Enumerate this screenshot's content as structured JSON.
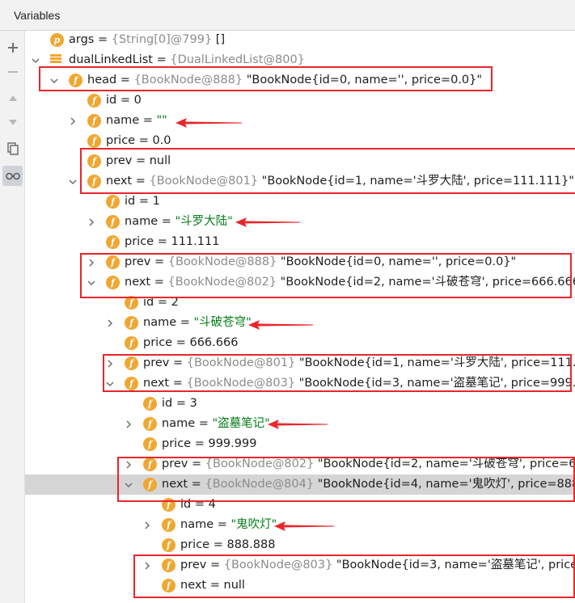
{
  "panel": {
    "title": "Variables"
  },
  "toolbar": [
    {
      "icon": "plus-icon",
      "glyph": "+"
    },
    {
      "icon": "minus-icon",
      "glyph": "−"
    },
    {
      "icon": "arrow-up-icon",
      "glyph": "▲"
    },
    {
      "icon": "arrow-down-icon",
      "glyph": "▼"
    },
    {
      "icon": "copy-icon",
      "glyph": "❐"
    },
    {
      "icon": "glasses-icon",
      "glyph": "👓"
    }
  ],
  "rows": [
    {
      "indent": 0,
      "chev": "",
      "icon": "p",
      "name": "args",
      "ref": "{String[0]@799}",
      "value": "[]",
      "valueColor": "black"
    },
    {
      "indent": 0,
      "chev": "down",
      "icon": "list",
      "name": "dualLinkedList",
      "ref": "{DualLinkedList@800}",
      "value": "",
      "valueColor": "black"
    },
    {
      "indent": 1,
      "chev": "down",
      "icon": "f",
      "name": "head",
      "ref": "{BookNode@888}",
      "value": "\"BookNode{id=0, name='', price=0.0}\"",
      "valueColor": "black"
    },
    {
      "indent": 2,
      "chev": "",
      "icon": "f",
      "name": "id",
      "ref": "",
      "value": "0",
      "valueColor": "black"
    },
    {
      "indent": 2,
      "chev": "right",
      "icon": "f",
      "name": "name",
      "ref": "",
      "value": "\"\"",
      "valueColor": "green"
    },
    {
      "indent": 2,
      "chev": "",
      "icon": "f",
      "name": "price",
      "ref": "",
      "value": "0.0",
      "valueColor": "black"
    },
    {
      "indent": 2,
      "chev": "",
      "icon": "f",
      "name": "prev",
      "ref": "",
      "value": "null",
      "valueColor": "black"
    },
    {
      "indent": 2,
      "chev": "down",
      "icon": "f",
      "name": "next",
      "ref": "{BookNode@801}",
      "value": "\"BookNode{id=1, name='斗罗大陆', price=111.111}\"",
      "valueColor": "black"
    },
    {
      "indent": 3,
      "chev": "",
      "icon": "f",
      "name": "id",
      "ref": "",
      "value": "1",
      "valueColor": "black"
    },
    {
      "indent": 3,
      "chev": "right",
      "icon": "f",
      "name": "name",
      "ref": "",
      "value": "\"斗罗大陆\"",
      "valueColor": "green"
    },
    {
      "indent": 3,
      "chev": "",
      "icon": "f",
      "name": "price",
      "ref": "",
      "value": "111.111",
      "valueColor": "black"
    },
    {
      "indent": 3,
      "chev": "right",
      "icon": "f",
      "name": "prev",
      "ref": "{BookNode@888}",
      "value": "\"BookNode{id=0, name='', price=0.0}\"",
      "valueColor": "black"
    },
    {
      "indent": 3,
      "chev": "down",
      "icon": "f",
      "name": "next",
      "ref": "{BookNode@802}",
      "value": "\"BookNode{id=2, name='斗破苍穹', price=666.666",
      "valueColor": "black"
    },
    {
      "indent": 4,
      "chev": "",
      "icon": "f",
      "name": "id",
      "ref": "",
      "value": "2",
      "valueColor": "black"
    },
    {
      "indent": 4,
      "chev": "right",
      "icon": "f",
      "name": "name",
      "ref": "",
      "value": "\"斗破苍穹\"",
      "valueColor": "green"
    },
    {
      "indent": 4,
      "chev": "",
      "icon": "f",
      "name": "price",
      "ref": "",
      "value": "666.666",
      "valueColor": "black"
    },
    {
      "indent": 4,
      "chev": "right",
      "icon": "f",
      "name": "prev",
      "ref": "{BookNode@801}",
      "value": "\"BookNode{id=1, name='斗罗大陆', price=111.",
      "valueColor": "black"
    },
    {
      "indent": 4,
      "chev": "down",
      "icon": "f",
      "name": "next",
      "ref": "{BookNode@803}",
      "value": "\"BookNode{id=3, name='盗墓笔记', price=999.9",
      "valueColor": "black"
    },
    {
      "indent": 5,
      "chev": "",
      "icon": "f",
      "name": "id",
      "ref": "",
      "value": "3",
      "valueColor": "black"
    },
    {
      "indent": 5,
      "chev": "right",
      "icon": "f",
      "name": "name",
      "ref": "",
      "value": "\"盗墓笔记\"",
      "valueColor": "green"
    },
    {
      "indent": 5,
      "chev": "",
      "icon": "f",
      "name": "price",
      "ref": "",
      "value": "999.999",
      "valueColor": "black"
    },
    {
      "indent": 5,
      "chev": "right",
      "icon": "f",
      "name": "prev",
      "ref": "{BookNode@802}",
      "value": "\"BookNode{id=2, name='斗破苍穹', price=66",
      "valueColor": "black"
    },
    {
      "indent": 5,
      "chev": "down",
      "icon": "f",
      "name": "next",
      "ref": "{BookNode@804}",
      "value": "\"BookNode{id=4, name='鬼吹灯', price=888",
      "valueColor": "black",
      "selected": true
    },
    {
      "indent": 6,
      "chev": "",
      "icon": "f",
      "name": "id",
      "ref": "",
      "value": "4",
      "valueColor": "black"
    },
    {
      "indent": 6,
      "chev": "right",
      "icon": "f",
      "name": "name",
      "ref": "",
      "value": "\"鬼吹灯\"",
      "valueColor": "green"
    },
    {
      "indent": 6,
      "chev": "",
      "icon": "f",
      "name": "price",
      "ref": "",
      "value": "888.888",
      "valueColor": "black"
    },
    {
      "indent": 6,
      "chev": "right",
      "icon": "f",
      "name": "prev",
      "ref": "{BookNode@803}",
      "value": "\"BookNode{id=3, name='盗墓笔记', price",
      "valueColor": "black"
    },
    {
      "indent": 6,
      "chev": "",
      "icon": "f",
      "name": "next",
      "ref": "",
      "value": "null",
      "valueColor": "black"
    }
  ],
  "annotations": {
    "box_color": "#e8262b",
    "arrow_color": "#e8262b"
  }
}
